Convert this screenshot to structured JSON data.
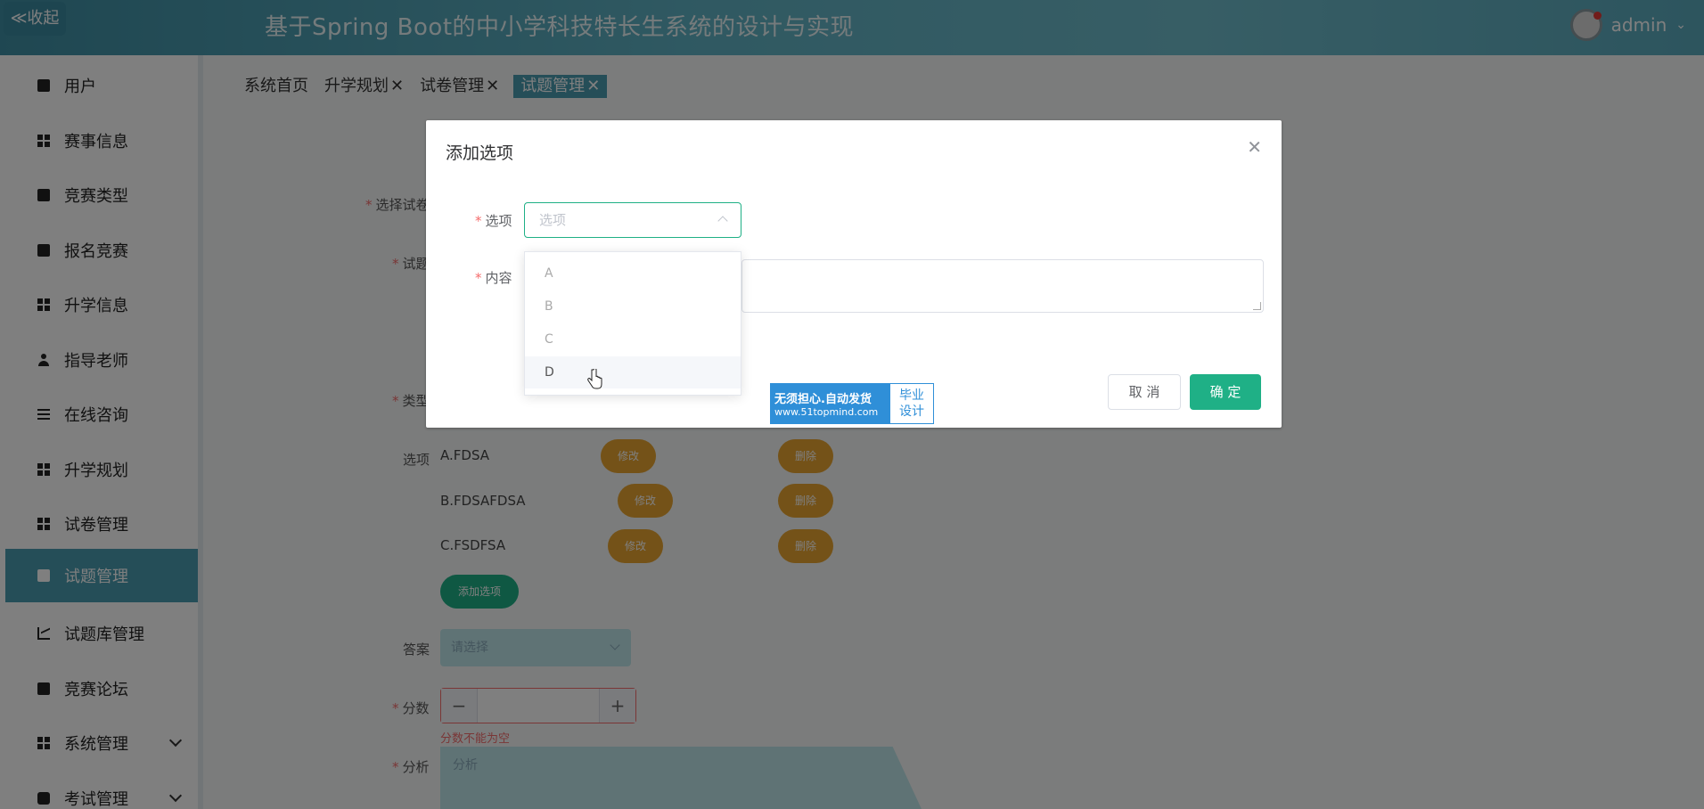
{
  "header": {
    "collapse_label": "≪收起",
    "title": "基于Spring Boot的中小学科技特长生系统的设计与实现",
    "user_name": "admin"
  },
  "sidebar": {
    "items": [
      {
        "label": "用户",
        "icon": "clipboard-icon"
      },
      {
        "label": "赛事信息",
        "icon": "grid-icon"
      },
      {
        "label": "竞赛类型",
        "icon": "clipboard-icon"
      },
      {
        "label": "报名竞赛",
        "icon": "wallet-icon"
      },
      {
        "label": "升学信息",
        "icon": "grid-icon"
      },
      {
        "label": "指导老师",
        "icon": "person-icon"
      },
      {
        "label": "在线咨询",
        "icon": "list-icon"
      },
      {
        "label": "升学规划",
        "icon": "grid-icon"
      },
      {
        "label": "试卷管理",
        "icon": "grid-icon"
      },
      {
        "label": "试题管理",
        "icon": "monitor-icon"
      },
      {
        "label": "试题库管理",
        "icon": "chart-icon"
      },
      {
        "label": "竞赛论坛",
        "icon": "ticket-icon"
      },
      {
        "label": "系统管理",
        "icon": "grid-icon"
      },
      {
        "label": "考试管理",
        "icon": "chat-icon"
      }
    ]
  },
  "tabs": [
    {
      "label": "系统首页",
      "closable": ""
    },
    {
      "label": "升学规划",
      "closable": "✕"
    },
    {
      "label": "试卷管理",
      "closable": "✕"
    },
    {
      "label": "试题管理",
      "closable": "✕"
    }
  ],
  "form": {
    "paper_label": "选择试卷",
    "question_label": "试题",
    "type_label": "类型",
    "options_label": "选项",
    "options": [
      {
        "text": "A.FDSA",
        "edit": "修改",
        "delete": "删除"
      },
      {
        "text": "B.FDSAFDSA",
        "edit": "修改",
        "delete": "删除"
      },
      {
        "text": "C.FSDFSA",
        "edit": "修改",
        "delete": "删除"
      }
    ],
    "add_option_label": "添加选项",
    "answer_label": "答案",
    "answer_placeholder": "请选择",
    "score_label": "分数",
    "score_error": "分数不能为空",
    "analysis_label": "分析",
    "analysis_placeholder": "分析"
  },
  "dialog": {
    "title": "添加选项",
    "option_label": "选项",
    "option_placeholder": "选项",
    "content_label": "内容",
    "cancel": "取 消",
    "confirm": "确 定",
    "dropdown_options": [
      "A",
      "B",
      "C",
      "D"
    ],
    "hovered_option": "D"
  },
  "watermark": {
    "line1": "无须担心.自动发货",
    "line2": "www.51topmind.com",
    "right1": "毕业",
    "right2": "设计"
  },
  "colors": {
    "header": "#5fb2c4",
    "sidebar_active": "#4a9db1",
    "primary_button": "#1fb086",
    "warning_button": "#e8a530",
    "error": "#f56c6c"
  }
}
